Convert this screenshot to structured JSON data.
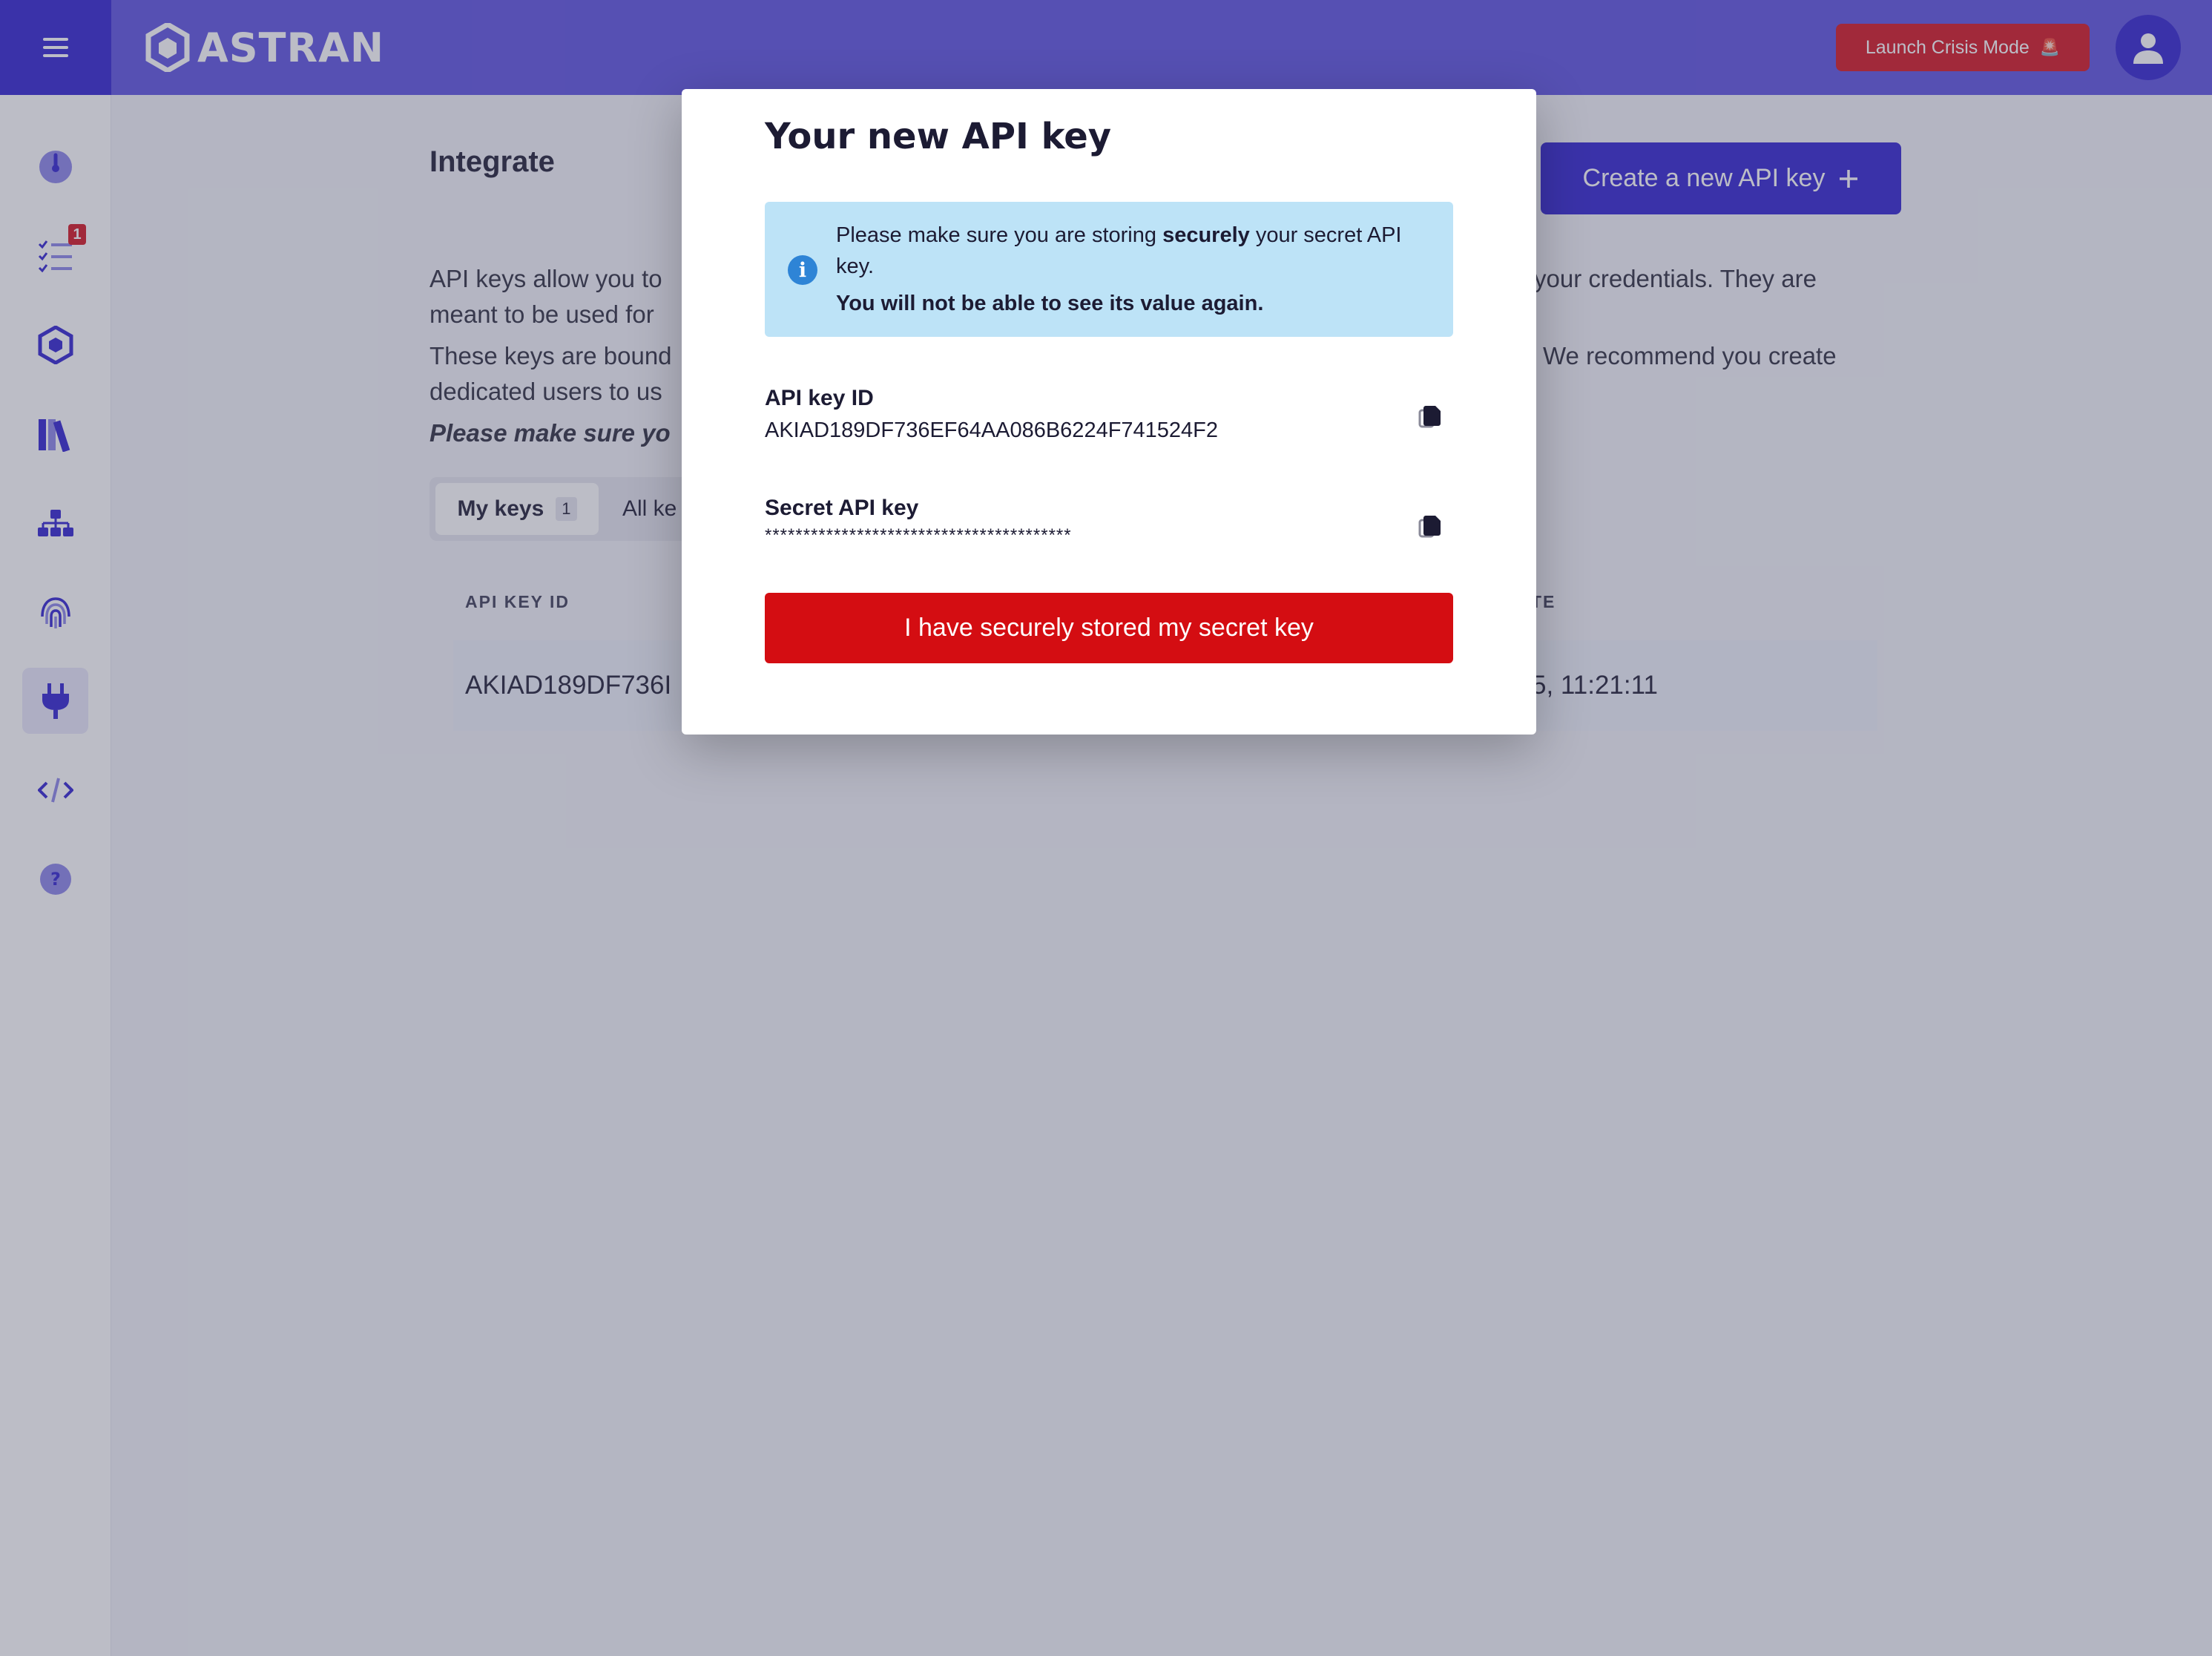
{
  "header": {
    "logo_text": "ASTRAN",
    "crisis_button": "Launch Crisis Mode",
    "crisis_emoji": "🚨",
    "menu_icon": "hamburger-icon",
    "avatar_icon": "user-icon"
  },
  "sidebar": {
    "items": [
      {
        "name": "dashboard",
        "icon": "gauge-icon"
      },
      {
        "name": "tasks",
        "icon": "checklist-icon",
        "badge": "1"
      },
      {
        "name": "spaces",
        "icon": "hexagon-cube-icon"
      },
      {
        "name": "library",
        "icon": "books-icon"
      },
      {
        "name": "organization",
        "icon": "org-chart-icon"
      },
      {
        "name": "identity",
        "icon": "fingerprint-icon"
      },
      {
        "name": "integrate",
        "icon": "plug-icon",
        "active": true
      },
      {
        "name": "developer",
        "icon": "code-icon"
      },
      {
        "name": "help",
        "icon": "help-icon"
      }
    ]
  },
  "page": {
    "title": "Integrate",
    "create_button": "Create a new API key",
    "para1_left_line1": "API keys allow you to",
    "para1_left_line2": "meant to be used for",
    "para1_right_line1": "your credentials. They are",
    "para2_left_line1": "These keys are bound",
    "para2_left_line2": "dedicated users to us",
    "para2_right_line1": "We recommend you create",
    "warning_partial": "Please make sure yo",
    "tabs": {
      "my_keys": "My keys",
      "my_keys_count": "1",
      "all_keys": "All ke"
    },
    "table": {
      "col_api_key_id": "API KEY ID",
      "col_date_partial": "TE",
      "row_key_id_partial": "AKIAD189DF736I",
      "row_date_partial": "5, 11:21:11"
    }
  },
  "modal": {
    "title": "Your new API key",
    "info_prefix": "Please make sure you are storing ",
    "info_bold": "securely",
    "info_suffix": " your secret API key.",
    "info_strong": "You will not be able to see its value again.",
    "api_key_id_label": "API key ID",
    "api_key_id_value": "AKIAD189DF736EF64AA086B6224F741524F2",
    "secret_label": "Secret API key",
    "secret_value": "****************************************",
    "confirm_button": "I have securely stored my secret key"
  },
  "colors": {
    "brand": "#2e1fd0",
    "topbar": "#5b4fe0",
    "danger": "#d40d12",
    "info_bg": "#bde3f7"
  }
}
